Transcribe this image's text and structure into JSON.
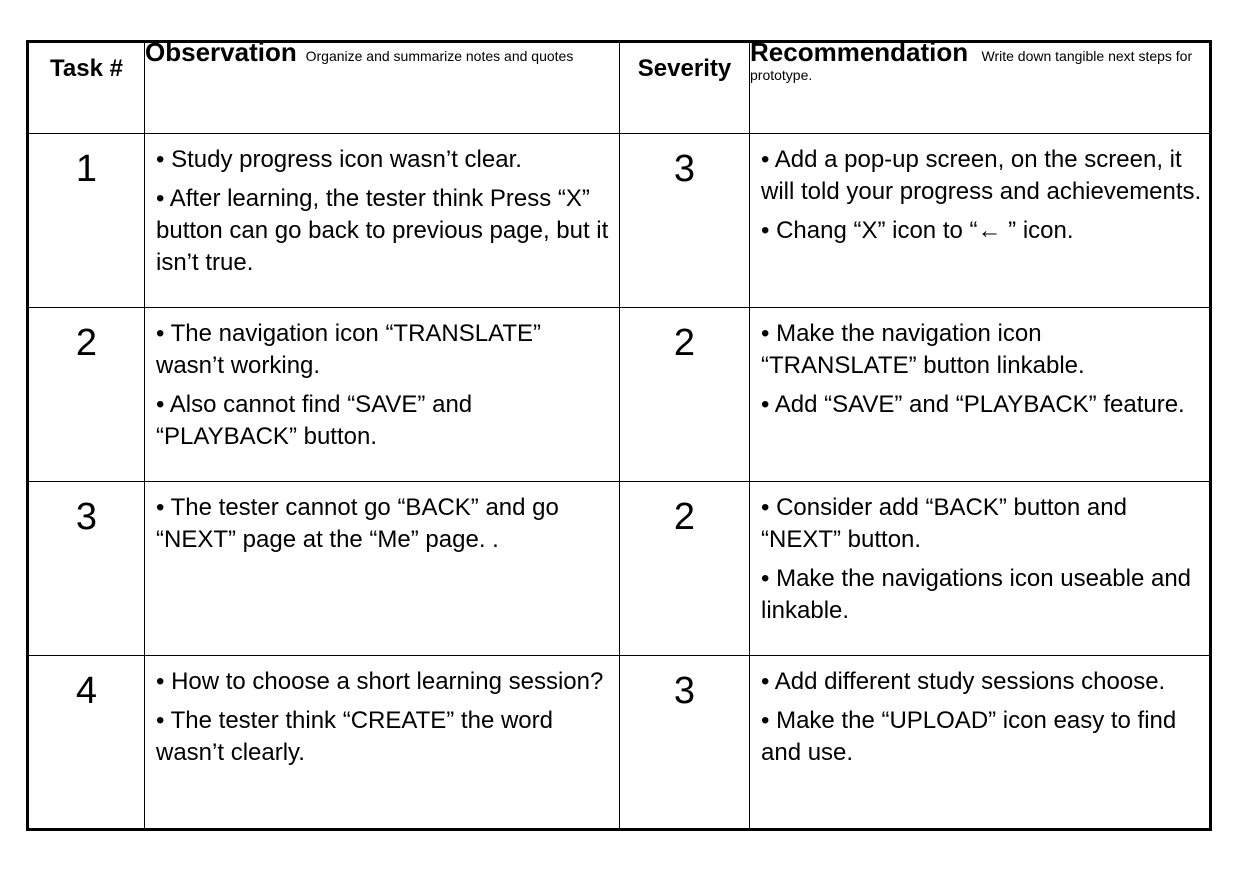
{
  "table": {
    "headers": {
      "task": "Task #",
      "observation": "Observation",
      "observation_hint": "Organize and summarize notes and quotes",
      "severity": "Severity",
      "recommendation": "Recommendation",
      "recommendation_hint": "Write down tangible next steps for prototype."
    },
    "rows": [
      {
        "task": "1",
        "severity": "3",
        "observations": [
          "• Study progress icon wasn’t clear.",
          "• After learning, the tester think Press “X” button can go back to previous page, but it isn’t true."
        ],
        "recommendations": [
          "• Add a pop-up screen, on the screen, it will told your progress and achievements.",
          "• Chang “X” icon to “← ” icon."
        ]
      },
      {
        "task": "2",
        "severity": "2",
        "observations": [
          "• The navigation icon “TRANSLATE” wasn’t working.",
          "• Also cannot find “SAVE” and “PLAYBACK” button."
        ],
        "recommendations": [
          "• Make the navigation icon “TRANSLATE” button linkable.",
          "• Add “SAVE” and “PLAYBACK” feature."
        ]
      },
      {
        "task": "3",
        "severity": "2",
        "observations": [
          "• The tester cannot go “BACK” and go “NEXT” page at the “Me” page. ."
        ],
        "recommendations": [
          "• Consider add “BACK” button and “NEXT” button.",
          "• Make the navigations icon useable and linkable."
        ]
      },
      {
        "task": "4",
        "severity": "3",
        "observations": [
          "• How to choose a short learning session?",
          "• The tester think “CREATE” the word wasn’t clearly."
        ],
        "recommendations": [
          "• Add different study sessions choose.",
          "• Make the “UPLOAD” icon easy to find and use."
        ]
      }
    ]
  }
}
